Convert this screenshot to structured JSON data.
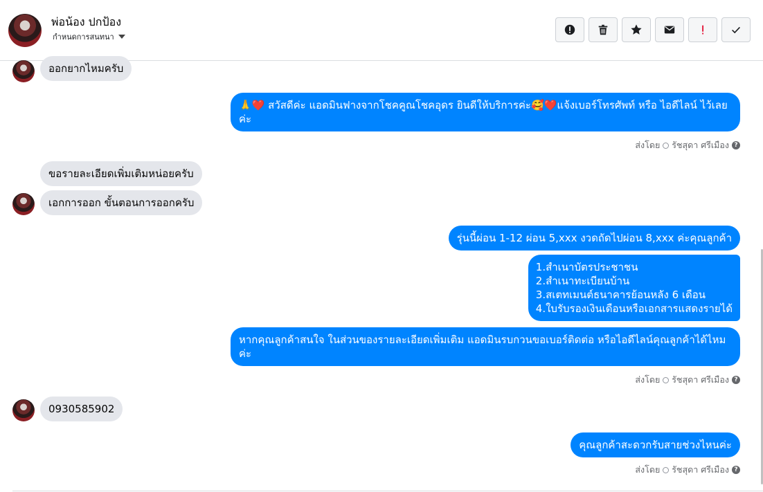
{
  "header": {
    "contact_name": "พ่อน้อง ปกป้อง",
    "assign_label": "กำหนดการสนทนา",
    "buttons": [
      {
        "icon": "alert-icon"
      },
      {
        "icon": "trash-icon"
      },
      {
        "icon": "star-icon"
      },
      {
        "icon": "mail-icon"
      },
      {
        "icon": "exclamation-icon"
      },
      {
        "icon": "check-icon"
      }
    ]
  },
  "messages": {
    "m1": "ออกยากไหมครับ",
    "m2a": "🙏❤️ สวัสดีค่ะ แอดมินฟางจากโชคคูณโชคอุดร ยินดีให้บริการค่ะ🥰❤️แจ้งเบอร์โทรศัพท์ หรือ ไอดีไลน์  ไว้เลย",
    "m2b": "ค่ะ",
    "m3": "ขอรายละเอียดเพิ่มเติมหน่อยครับ",
    "m4": "เอกการออก ขั้นตอนการออกครับ",
    "m5": "รุ่นนี้ผ่อน 1-12 ผ่อน 5,xxx งวดถัดไปผ่อน 8,xxx ค่ะคุณลูกค้า",
    "m6": [
      "1.สำเนาบัตรประชาชน",
      "2.สำเนาทะเบียนบ้าน",
      "3.สเตทเมนต์ธนาคารย้อนหลัง 6 เดือน",
      "4.ใบรับรองเงินเดือนหรือเอกสารแสดงรายได้"
    ],
    "m7a": "หากคุณลูกค้าสนใจ ในส่วนของรายละเอียดเพิ่มเติม แอดมินรบกวนขอเบอร์ติดต่อ หรือไอดีไลน์คุณลูกค้าได้ไหม",
    "m7b": "ค่ะ",
    "m8": "0930585902",
    "m9": "คุณลูกค้าสะดวกรับสายช่วงไหนค่ะ"
  },
  "sent_by": {
    "label": "ส่งโดย",
    "agent": "รัชสุดา ศรีเมือง",
    "help": "?"
  },
  "colors": {
    "outgoing_bubble": "#0084ff",
    "incoming_bubble": "#e4e6eb",
    "exclamation": "#e41e3f"
  }
}
